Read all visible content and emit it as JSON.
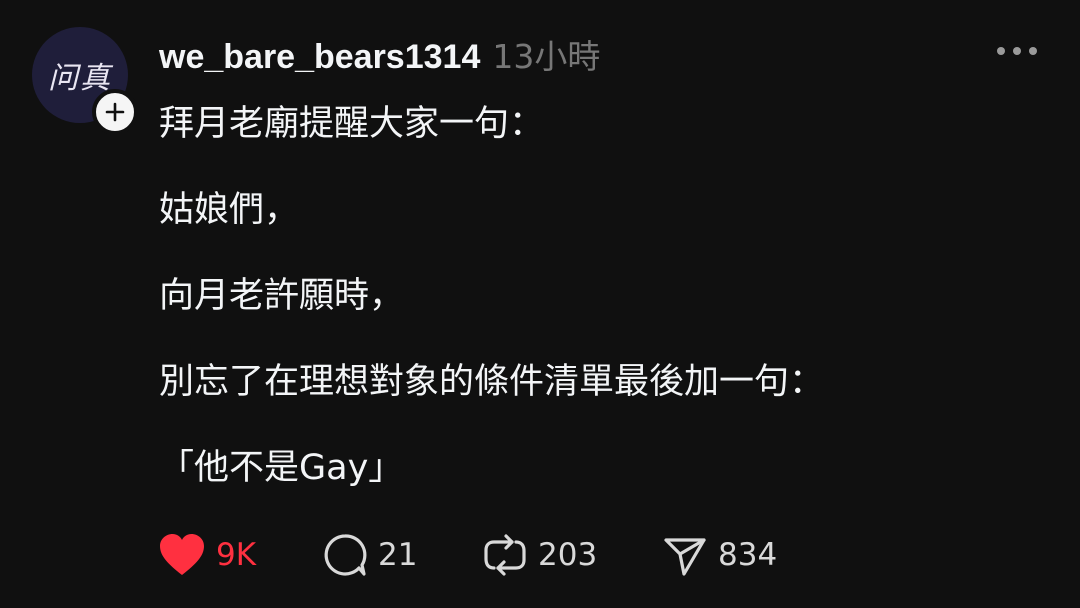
{
  "post": {
    "avatar_text": "问真",
    "username": "we_bare_bears1314",
    "time": "13小時",
    "lines": [
      "拜月老廟提醒大家一句：",
      "姑娘們，",
      "向月老許願時，",
      "別忘了在理想對象的條件清單最後加一句：",
      "「他不是Gay」"
    ]
  },
  "actions": {
    "likes": "9K",
    "replies": "21",
    "reposts": "203",
    "shares": "834"
  },
  "colors": {
    "background": "#101010",
    "like_active": "#ff3040",
    "muted": "#777777"
  },
  "icons": [
    "plus-icon",
    "more-icon",
    "heart-icon",
    "comment-icon",
    "repost-icon",
    "share-icon"
  ]
}
